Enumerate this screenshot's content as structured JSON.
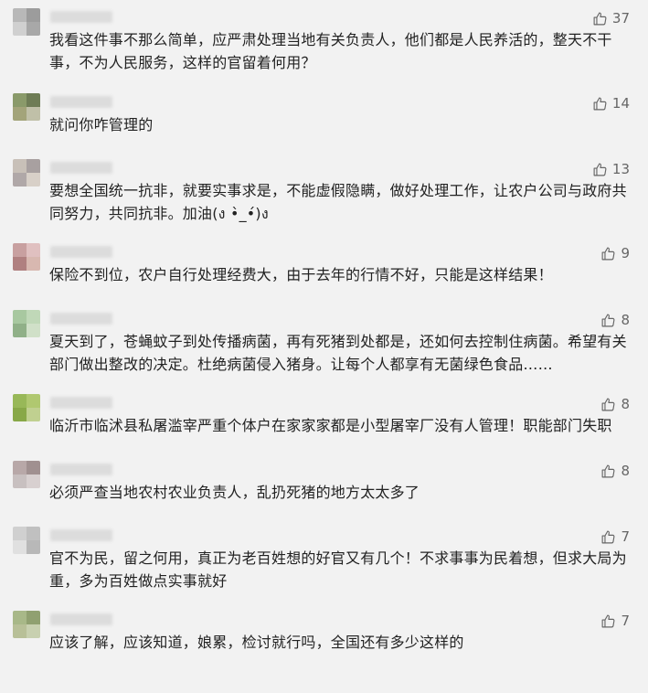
{
  "comments": [
    {
      "likes": "37",
      "text": "我看这件事不那么简单，应严肃处理当地有关负责人，他们都是人民养活的，整天不干事，不为人民服务，这样的官留着何用？",
      "avatar": [
        "#b8b8b8",
        "#9c9c9c",
        "#d0d0d0",
        "#a8a8a8"
      ]
    },
    {
      "likes": "14",
      "text": "就问你咋管理的",
      "avatar": [
        "#8a9a6a",
        "#6e7c55",
        "#a3a47a",
        "#c0c0a8"
      ]
    },
    {
      "likes": "13",
      "text": "要想全国统一抗非，就要实事求是，不能虚假隐瞒，做好处理工作，让农户公司与政府共同努力，共同抗非。加油(ง •̀_•́)ง",
      "avatar": [
        "#c8c0b8",
        "#a8a0a0",
        "#b0a8a8",
        "#d8d0c8"
      ]
    },
    {
      "likes": "9",
      "text": "保险不到位，农户自行处理经费大，由于去年的行情不好，只能是这样结果！",
      "avatar": [
        "#c8a0a0",
        "#e0c0c0",
        "#b08080",
        "#d8b8b0"
      ]
    },
    {
      "likes": "8",
      "text": "夏天到了，苍蝇蚊子到处传播病菌，再有死猪到处都是，还如何去控制住病菌。希望有关部门做出整改的决定。杜绝病菌侵入猪身。让每个人都享有无菌绿色食品……",
      "avatar": [
        "#a8c8a0",
        "#c0d8b8",
        "#90b088",
        "#d0e0c8"
      ]
    },
    {
      "likes": "8",
      "text": "临沂市临沭县私屠滥宰严重个体户在家家家都是小型屠宰厂没有人管理！职能部门失职",
      "avatar": [
        "#98b858",
        "#b0c870",
        "#88a848",
        "#c0d090"
      ]
    },
    {
      "likes": "8",
      "text": "必须严查当地农村农业负责人，乱扔死猪的地方太太多了",
      "avatar": [
        "#b8a8a8",
        "#a09090",
        "#c8c0c0",
        "#d8d0d0"
      ]
    },
    {
      "likes": "7",
      "text": "官不为民，留之何用，真正为老百姓想的好官又有几个！不求事事为民着想，但求大局为重，多为百姓做点实事就好",
      "avatar": [
        "#d0d0d0",
        "#c0c0c0",
        "#e0e0e0",
        "#b8b8b8"
      ]
    },
    {
      "likes": "7",
      "text": "应该了解，应该知道，娘累，检讨就行吗，全国还有多少这样的",
      "avatar": [
        "#a8b888",
        "#90a070",
        "#b8c098",
        "#c8d0b0"
      ]
    }
  ]
}
